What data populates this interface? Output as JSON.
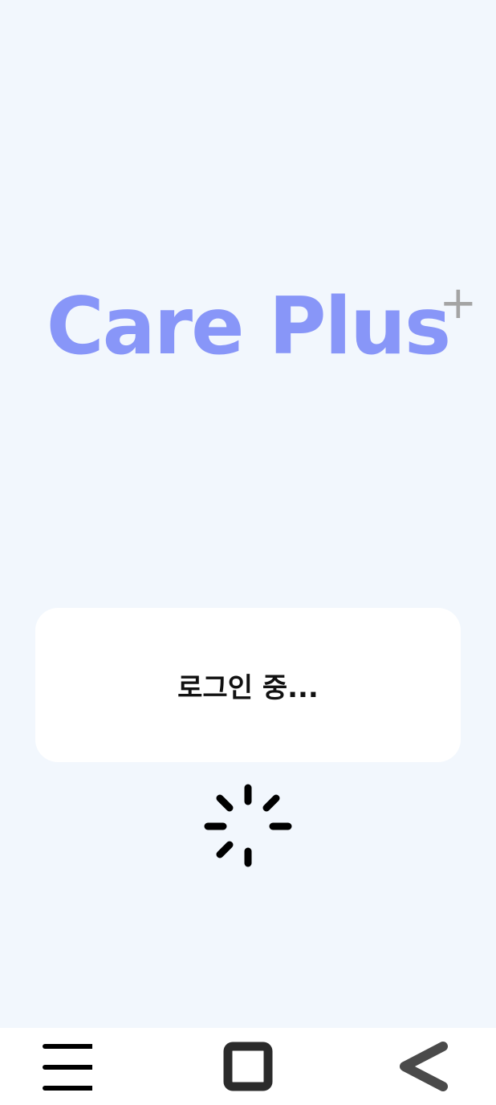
{
  "app": {
    "logo_text": "Care Plus",
    "logo_superscript": "+",
    "brand_color": "#8896f8"
  },
  "status": {
    "message": "로그인 중..."
  },
  "icons": {
    "spinner": "loading-spinner-icon",
    "menu": "menu-icon",
    "home": "home-square-icon",
    "back": "back-chevron-icon"
  }
}
